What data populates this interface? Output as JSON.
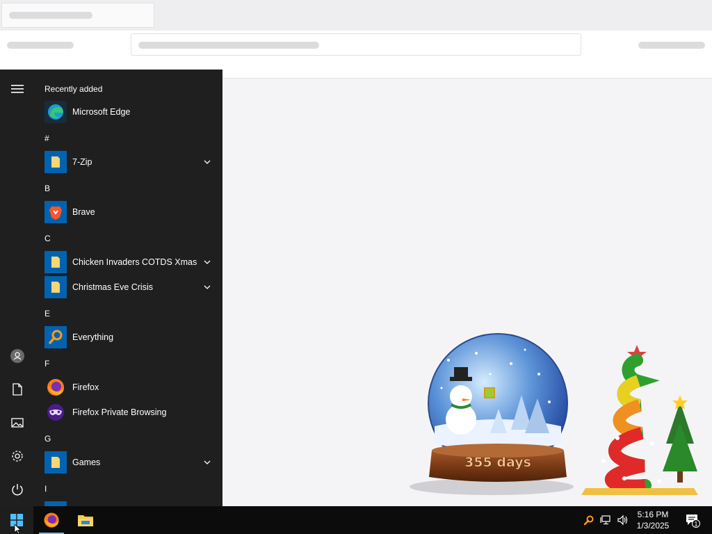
{
  "start_menu": {
    "sections": [
      {
        "header": "Recently added",
        "apps": [
          {
            "label": "Microsoft Edge",
            "icon": "edge-icon",
            "expandable": false
          }
        ]
      },
      {
        "header": "#",
        "apps": [
          {
            "label": "7-Zip",
            "icon": "folder-icon",
            "expandable": true
          }
        ]
      },
      {
        "header": "B",
        "apps": [
          {
            "label": "Brave",
            "icon": "brave-icon",
            "expandable": false
          }
        ]
      },
      {
        "header": "C",
        "apps": [
          {
            "label": "Chicken Invaders COTDS Xmas",
            "icon": "folder-icon",
            "expandable": true
          },
          {
            "label": "Christmas Eve Crisis",
            "icon": "folder-icon",
            "expandable": true
          }
        ]
      },
      {
        "header": "E",
        "apps": [
          {
            "label": "Everything",
            "icon": "magnifier-icon",
            "expandable": false
          }
        ]
      },
      {
        "header": "F",
        "apps": [
          {
            "label": "Firefox",
            "icon": "firefox-icon",
            "expandable": false
          },
          {
            "label": "Firefox Private Browsing",
            "icon": "private-mask-icon",
            "expandable": false
          }
        ]
      },
      {
        "header": "G",
        "apps": [
          {
            "label": "Games",
            "icon": "folder-icon",
            "expandable": true
          }
        ]
      },
      {
        "header": "I",
        "apps": []
      }
    ],
    "rail": [
      "hamburger-icon",
      "user-avatar-icon",
      "documents-icon",
      "pictures-icon",
      "settings-gear-icon",
      "power-icon"
    ]
  },
  "desktop": {
    "snowglobe_text": "355 days"
  },
  "taskbar": {
    "time": "5:16 PM",
    "date": "1/3/2025",
    "notification_count": "1",
    "accent_color": "#76b9ed",
    "pinned": [
      "start-windows-icon",
      "firefox-icon",
      "file-explorer-icon"
    ],
    "tray": [
      "everything-search-icon",
      "network-icon",
      "volume-icon"
    ]
  }
}
